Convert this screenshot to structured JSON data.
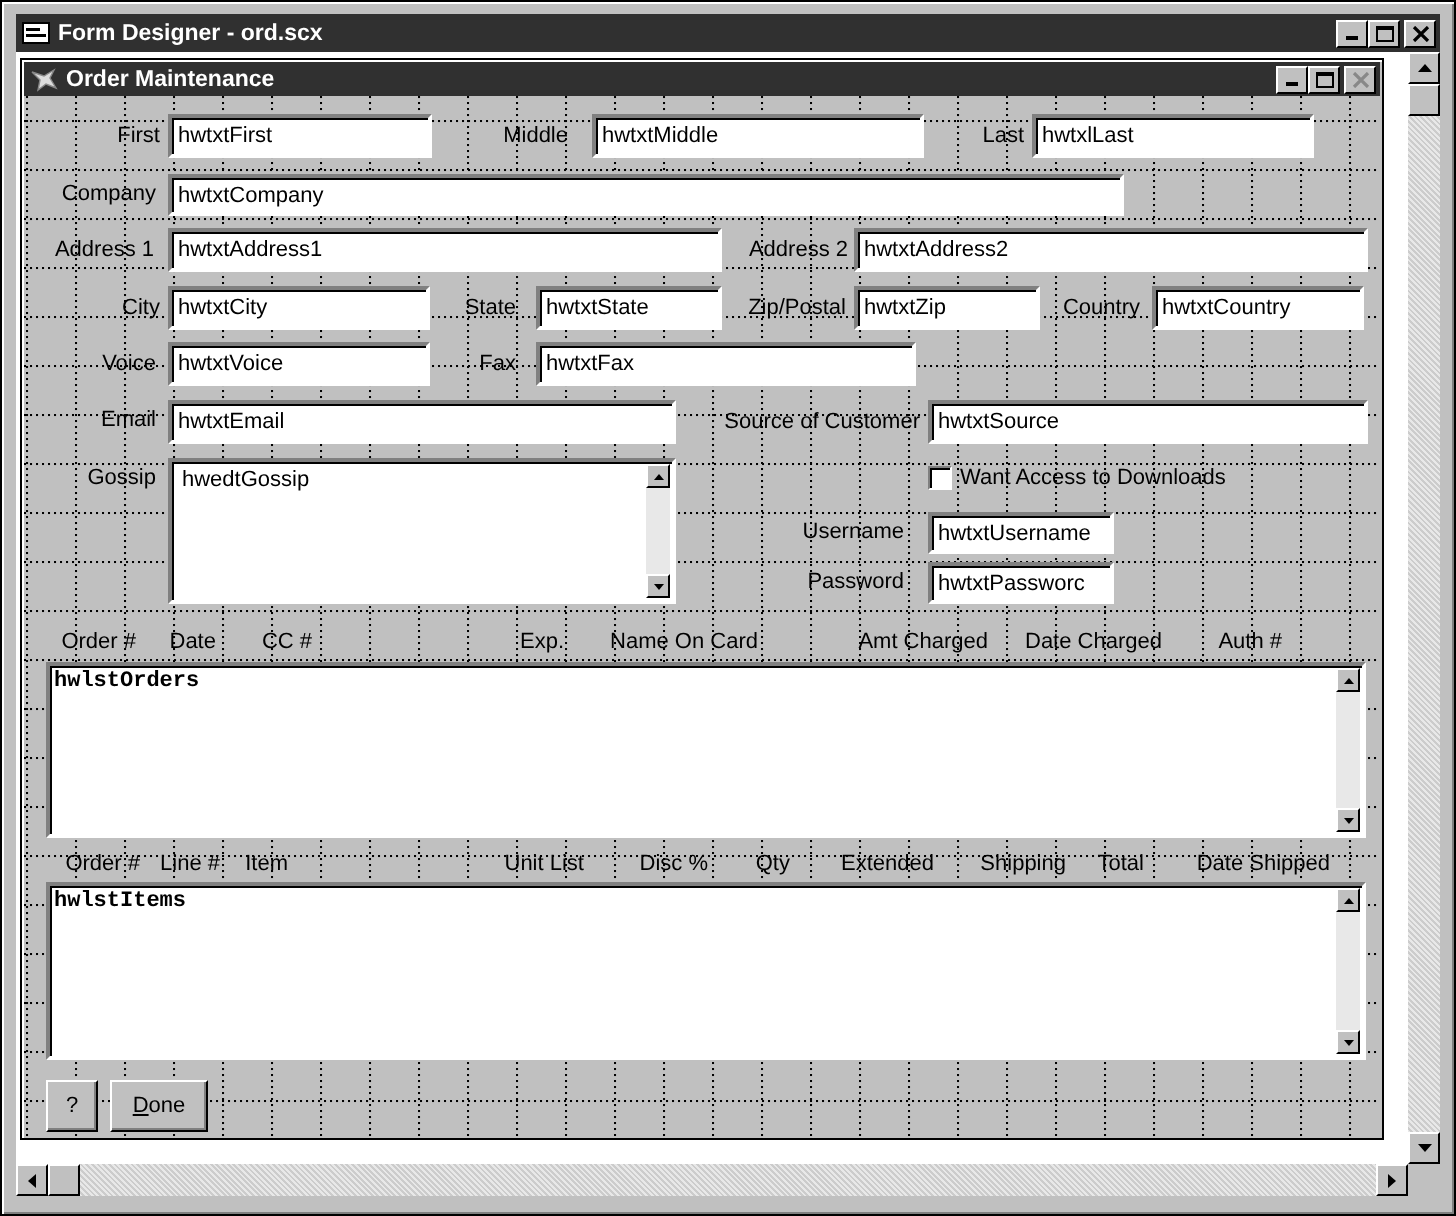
{
  "window": {
    "title": "Form Designer - ord.scx"
  },
  "form": {
    "title": "Order Maintenance",
    "controls": [
      {
        "kind": "label",
        "text": "First"
      },
      {
        "kind": "textbox",
        "value": "hwtxtFirst"
      },
      {
        "kind": "label",
        "text": "Middle"
      },
      {
        "kind": "textbox",
        "value": "hwtxtMiddle"
      },
      {
        "kind": "label",
        "text": "Last"
      },
      {
        "kind": "textbox",
        "value": "hwtxlLast"
      },
      {
        "kind": "label",
        "text": "Company"
      },
      {
        "kind": "textbox",
        "value": "hwtxtCompany"
      },
      {
        "kind": "label",
        "text": "Address 1"
      },
      {
        "kind": "textbox",
        "value": "hwtxtAddress1"
      },
      {
        "kind": "label",
        "text": "Address 2"
      },
      {
        "kind": "textbox",
        "value": "hwtxtAddress2"
      },
      {
        "kind": "label",
        "text": "City"
      },
      {
        "kind": "textbox",
        "value": "hwtxtCity"
      },
      {
        "kind": "label",
        "text": "State"
      },
      {
        "kind": "textbox",
        "value": "hwtxtState"
      },
      {
        "kind": "label",
        "text": "Zip/Postal"
      },
      {
        "kind": "textbox",
        "value": "hwtxtZip"
      },
      {
        "kind": "label",
        "text": "Country"
      },
      {
        "kind": "textbox",
        "value": "hwtxtCountry"
      },
      {
        "kind": "label",
        "text": "Voice"
      },
      {
        "kind": "textbox",
        "value": "hwtxtVoice"
      },
      {
        "kind": "label",
        "text": "Fax"
      },
      {
        "kind": "textbox",
        "value": "hwtxtFax"
      },
      {
        "kind": "label",
        "text": "Email"
      },
      {
        "kind": "textbox",
        "value": "hwtxtEmail"
      },
      {
        "kind": "label",
        "text": "Source of Customer"
      },
      {
        "kind": "textbox",
        "value": "hwtxtSource"
      },
      {
        "kind": "label",
        "text": "Gossip"
      },
      {
        "kind": "editbox",
        "value": "hwedtGossip"
      },
      {
        "kind": "checkbox",
        "text": "Want Access to Downloads",
        "checked": false
      },
      {
        "kind": "label",
        "text": "Username"
      },
      {
        "kind": "textbox",
        "value": "hwtxtUsername"
      },
      {
        "kind": "label",
        "text": "Password"
      },
      {
        "kind": "textbox",
        "value": "hwtxtPassworc"
      },
      {
        "kind": "label",
        "text": "Order #"
      },
      {
        "kind": "label",
        "text": "Date"
      },
      {
        "kind": "label",
        "text": "CC #"
      },
      {
        "kind": "label",
        "text": "Exp."
      },
      {
        "kind": "label",
        "text": "Name On Card"
      },
      {
        "kind": "label",
        "text": "Amt Charged"
      },
      {
        "kind": "label",
        "text": "Date Charged"
      },
      {
        "kind": "label",
        "text": "Auth #"
      },
      {
        "kind": "listbox",
        "value": "hwlstOrders"
      },
      {
        "kind": "label",
        "text": "Order #"
      },
      {
        "kind": "label",
        "text": "Line #"
      },
      {
        "kind": "label",
        "text": "Item"
      },
      {
        "kind": "label",
        "text": "Unit List"
      },
      {
        "kind": "label",
        "text": "Disc %"
      },
      {
        "kind": "label",
        "text": "Qty"
      },
      {
        "kind": "label",
        "text": "Extended"
      },
      {
        "kind": "label",
        "text": "Shipping"
      },
      {
        "kind": "label",
        "text": "Total"
      },
      {
        "kind": "label",
        "text": "Date Shipped"
      },
      {
        "kind": "listbox",
        "value": "hwlstItems"
      },
      {
        "kind": "button",
        "text": "?"
      },
      {
        "kind": "button",
        "text": "Done"
      }
    ]
  }
}
